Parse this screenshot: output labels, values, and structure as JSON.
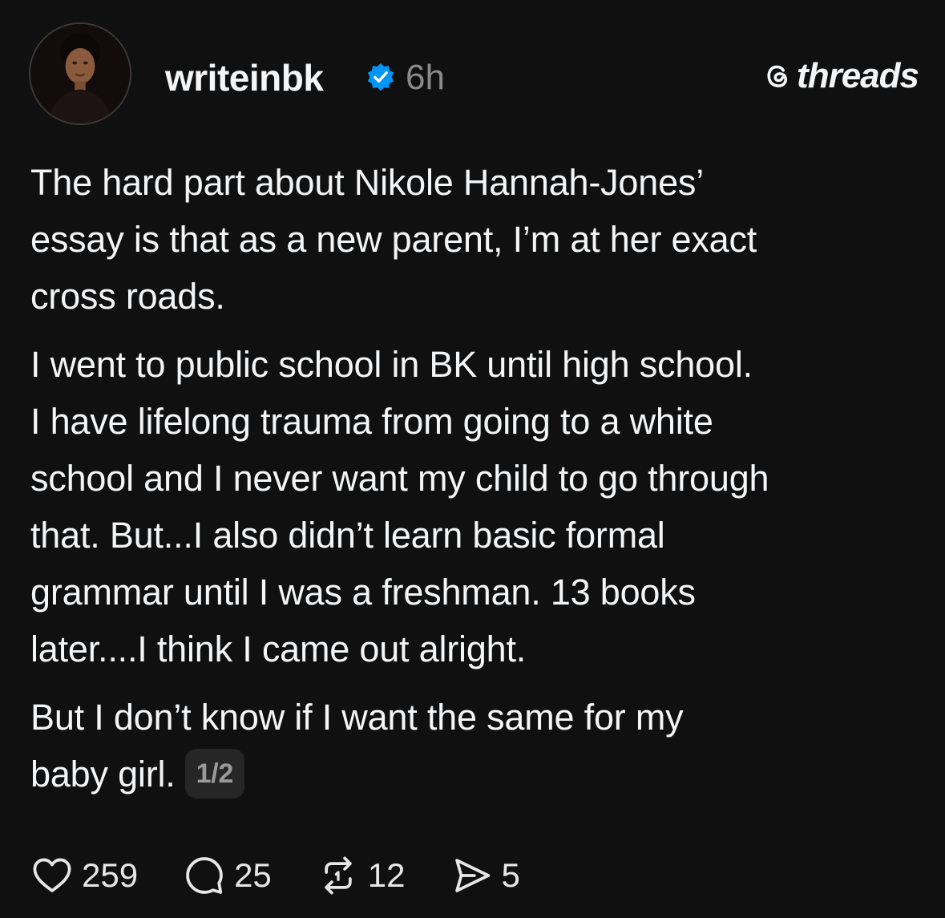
{
  "post": {
    "username": "writeinbk",
    "timestamp": "6h",
    "brand": "threads",
    "paragraphs": [
      [
        "The hard part about Nikole Hannah-Jones’",
        "essay is that as a new parent, I’m at her exact",
        "cross roads."
      ],
      [
        "I went to public school in BK until high school.",
        "I have lifelong trauma from going to a white",
        "school and I never want my child to go through",
        "that. But...I also didn’t learn basic formal",
        "grammar until I was a freshman. 13 books",
        "later....I think I came out alright."
      ],
      [
        "But I don’t know if I want the same for my",
        "baby girl."
      ]
    ],
    "page_indicator": "1/2"
  },
  "actions": {
    "likes": "259",
    "replies": "25",
    "reposts": "12",
    "shares": "5"
  },
  "icons": {
    "verified": "verified-badge-icon",
    "like": "heart-icon",
    "reply": "comment-icon",
    "repost": "repost-icon",
    "share": "send-icon",
    "brand": "threads-logo-icon"
  },
  "colors": {
    "background": "#101010",
    "text": "#f3f5f7",
    "muted": "#8a8a8a",
    "verified": "#0095f6"
  }
}
